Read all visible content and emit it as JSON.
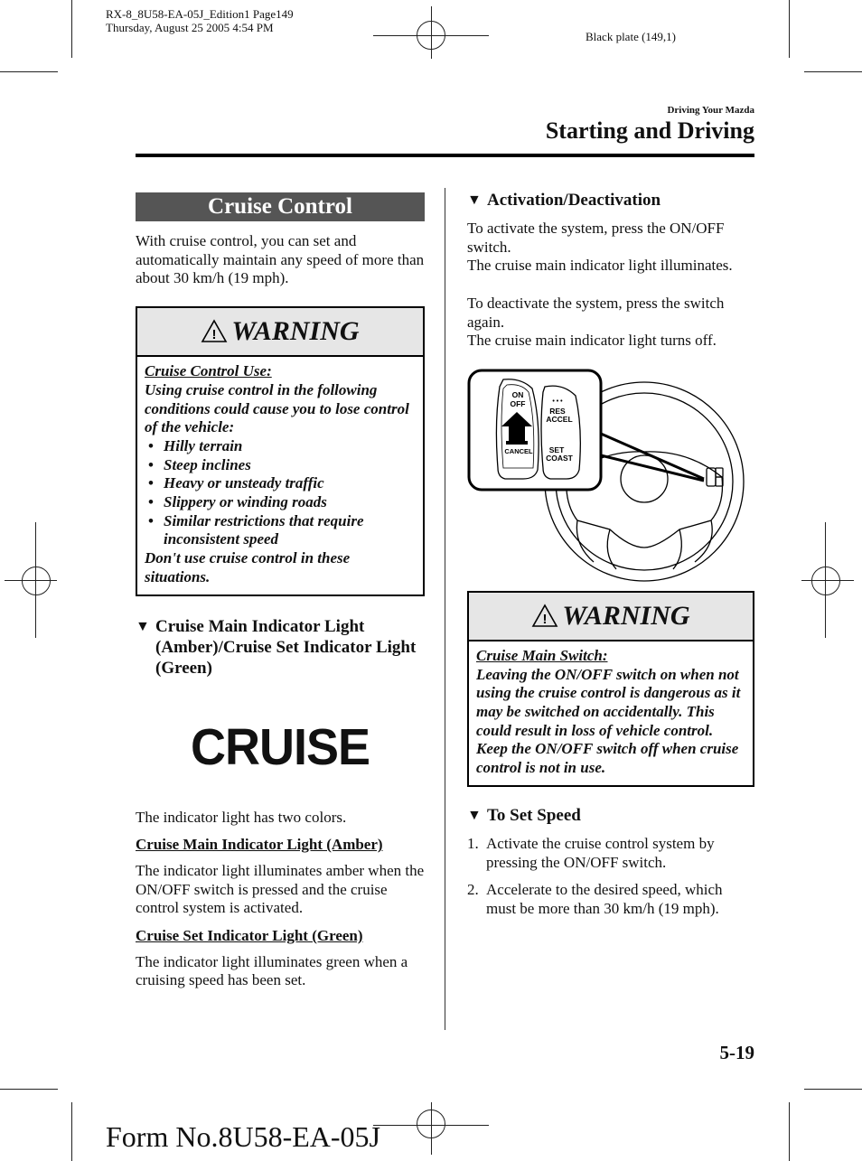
{
  "print_slug": {
    "line1": "RX-8_8U58-EA-05J_Edition1 Page149",
    "line2": "Thursday, August 25 2005 4:54 PM",
    "plate": "Black plate (149,1)"
  },
  "header": {
    "category": "Driving Your Mazda",
    "title": "Starting and Driving"
  },
  "left_column": {
    "topic_title": "Cruise Control",
    "intro": "With cruise control, you can set and automatically maintain any speed of more than about 30 km/h (19 mph).",
    "warning": {
      "icon": "warning-triangle-icon",
      "label": "WARNING",
      "subtitle": "Cruise Control Use:",
      "text": "Using cruise control in the following conditions could cause you to lose control of the vehicle:",
      "items": [
        "Hilly terrain",
        "Steep inclines",
        "Heavy or unsteady traffic",
        "Slippery or winding roads",
        "Similar restrictions that require inconsistent speed"
      ],
      "closing": "Don't use cruise control in these situations."
    },
    "indicator_section": {
      "marker": "▼",
      "heading": "Cruise Main Indicator Light (Amber)/Cruise Set Indicator Light (Green)",
      "symbol_text": "CRUISE",
      "intro": "The indicator light has two colors.",
      "amber_heading": "Cruise Main Indicator Light (Amber)",
      "amber_text": "The indicator light illuminates amber when the ON/OFF switch is pressed and the cruise control system is activated.",
      "green_heading": "Cruise Set Indicator Light (Green)",
      "green_text": "The indicator light illuminates green when a cruising speed has been set."
    }
  },
  "right_column": {
    "activation": {
      "marker": "▼",
      "heading": "Activation/Deactivation",
      "para1_line1": "To activate the system, press the ON/OFF switch.",
      "para1_line2": "The cruise main indicator light illuminates.",
      "para2_line1": "To deactivate the system, press the switch again.",
      "para2_line2": "The cruise main indicator light turns off."
    },
    "illustration": {
      "switch_labels": {
        "on": "ON",
        "off": "OFF",
        "cancel": "CANCEL",
        "res": "RES",
        "accel": "ACCEL",
        "set": "SET",
        "coast": "COAST"
      }
    },
    "warning": {
      "icon": "warning-triangle-icon",
      "label": "WARNING",
      "subtitle": "Cruise Main Switch:",
      "text": "Leaving the ON/OFF switch on when not using the cruise control is dangerous as it may be switched on accidentally. This could result in loss of vehicle control. Keep the ON/OFF switch off when cruise control is not in use."
    },
    "set_speed": {
      "marker": "▼",
      "heading": "To Set Speed",
      "steps": [
        {
          "num": "1.",
          "text": "Activate the cruise control system by pressing the ON/OFF switch."
        },
        {
          "num": "2.",
          "text": "Accelerate to the desired speed, which must be more than 30 km/h (19 mph)."
        }
      ]
    }
  },
  "footer": {
    "page_number": "5-19",
    "form_number": "Form No.8U58-EA-05J"
  }
}
